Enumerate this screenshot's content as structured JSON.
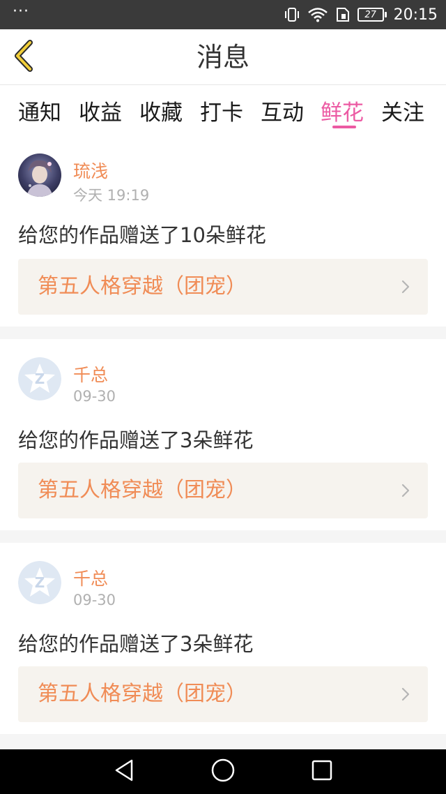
{
  "status_bar": {
    "dots": "···",
    "battery": "27",
    "time": "20:15"
  },
  "header": {
    "title": "消息",
    "back_icon": "chevron-left-icon"
  },
  "tabs": [
    {
      "label": "通知",
      "active": false
    },
    {
      "label": "收益",
      "active": false
    },
    {
      "label": "收藏",
      "active": false
    },
    {
      "label": "打卡",
      "active": false
    },
    {
      "label": "互动",
      "active": false
    },
    {
      "label": "鲜花",
      "active": true
    },
    {
      "label": "关注",
      "active": false
    }
  ],
  "messages": [
    {
      "user": "琉浅",
      "time": "今天 19:19",
      "text": "给您的作品赠送了10朵鲜花",
      "work": "第五人格穿越（团宠）",
      "avatar": "anime-avatar"
    },
    {
      "user": "千总",
      "time": "09-30",
      "text": "给您的作品赠送了3朵鲜花",
      "work": "第五人格穿越（团宠）",
      "avatar": "default-avatar"
    },
    {
      "user": "千总",
      "time": "09-30",
      "text": "给您的作品赠送了3朵鲜花",
      "work": "第五人格穿越（团宠）",
      "avatar": "default-avatar"
    }
  ],
  "colors": {
    "accent": "#ec5aa3",
    "name": "#f08c56",
    "status_bar": "#3a3a3a",
    "link_bg": "#f6f3ee"
  }
}
